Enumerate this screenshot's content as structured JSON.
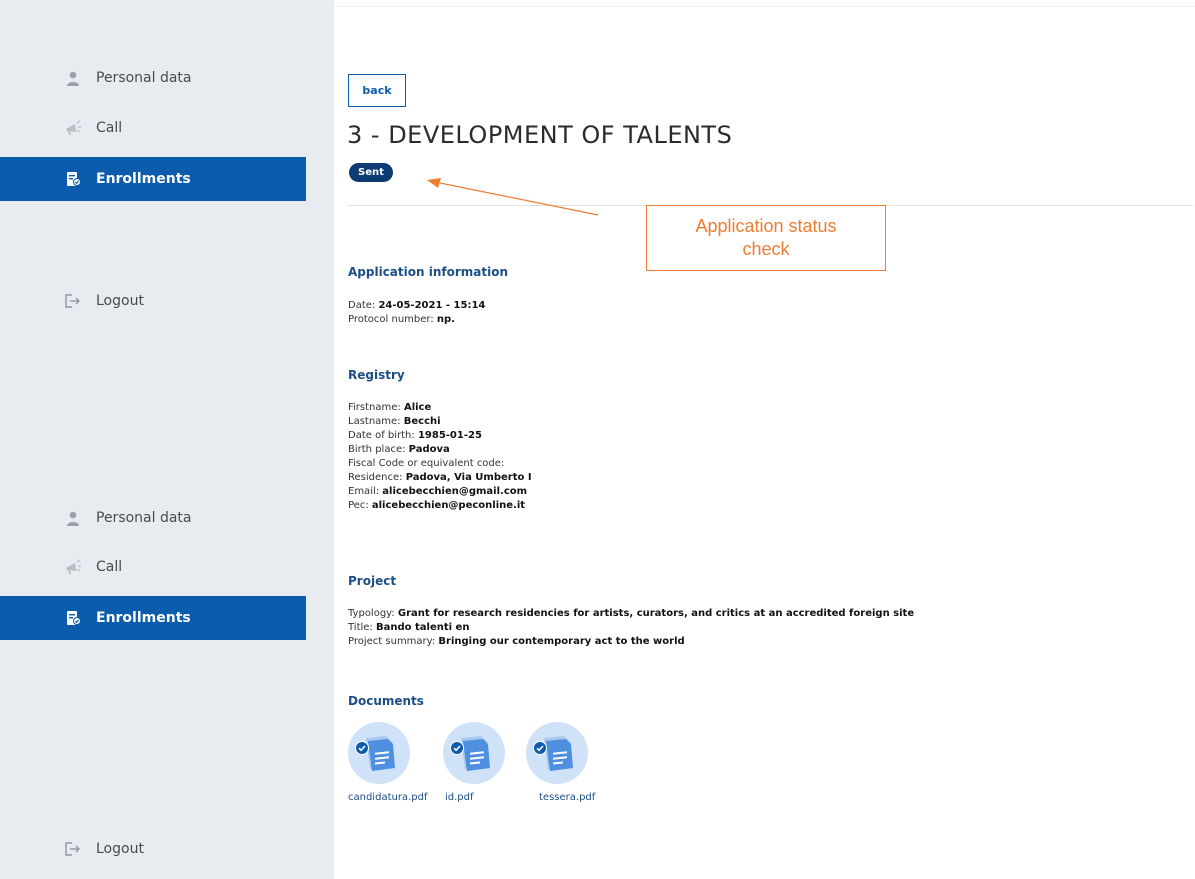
{
  "nav": {
    "top": [
      {
        "key": "personal",
        "label": "Personal data",
        "icon": "user-icon",
        "active": false
      },
      {
        "key": "call",
        "label": "Call",
        "icon": "megaphone-icon",
        "active": false
      },
      {
        "key": "enrollments",
        "label": "Enrollments",
        "icon": "enrollment-doc-icon",
        "active": true
      },
      {
        "key": "logout",
        "label": "Logout",
        "icon": "logout-icon",
        "active": false
      }
    ],
    "bottom": [
      {
        "key": "personal",
        "label": "Personal data",
        "icon": "user-icon",
        "active": false
      },
      {
        "key": "call",
        "label": "Call",
        "icon": "megaphone-icon",
        "active": false
      },
      {
        "key": "enrollments",
        "label": "Enrollments",
        "icon": "enrollment-doc-icon",
        "active": true
      },
      {
        "key": "logout",
        "label": "Logout",
        "icon": "logout-icon",
        "active": false
      }
    ]
  },
  "header": {
    "back_label": "back",
    "title": "3 - DEVELOPMENT OF TALENTS",
    "status": "Sent"
  },
  "annotation": {
    "line1": "Application status",
    "line2": "check"
  },
  "application_info": {
    "title": "Application information",
    "date_label": "Date: ",
    "date_value": "24-05-2021 - 15:14",
    "protocol_label": "Protocol number: ",
    "protocol_value": "np."
  },
  "registry": {
    "title": "Registry",
    "fields": [
      {
        "label": "Firstname: ",
        "value": "Alice"
      },
      {
        "label": "Lastname: ",
        "value": "Becchi"
      },
      {
        "label": "Date of birth: ",
        "value": "1985-01-25"
      },
      {
        "label": "Birth place: ",
        "value": "Padova"
      },
      {
        "label": "Fiscal Code or equivalent code: ",
        "value": ""
      },
      {
        "label": "Residence: ",
        "value": "Padova, Via Umberto I"
      },
      {
        "label": "Email: ",
        "value": "alicebecchien@gmail.com"
      },
      {
        "label": "Pec: ",
        "value": "alicebecchien@peconline.it"
      }
    ]
  },
  "project": {
    "title": "Project",
    "fields": [
      {
        "label": "Typology: ",
        "value": "Grant for research residencies for artists, curators, and critics at an accredited foreign site"
      },
      {
        "label": "Title: ",
        "value": "Bando talenti en"
      },
      {
        "label": "Project summary: ",
        "value": "Bringing our contemporary act to the world"
      }
    ]
  },
  "documents": {
    "title": "Documents",
    "files": [
      {
        "name": "candidatura.pdf"
      },
      {
        "name": "id.pdf"
      },
      {
        "name": "tessera.pdf"
      }
    ]
  },
  "colors": {
    "accent": "#0b5cad",
    "badge": "#0d3b73",
    "annotation": "#ed7d31",
    "sidebar": "#e8ecf1"
  }
}
